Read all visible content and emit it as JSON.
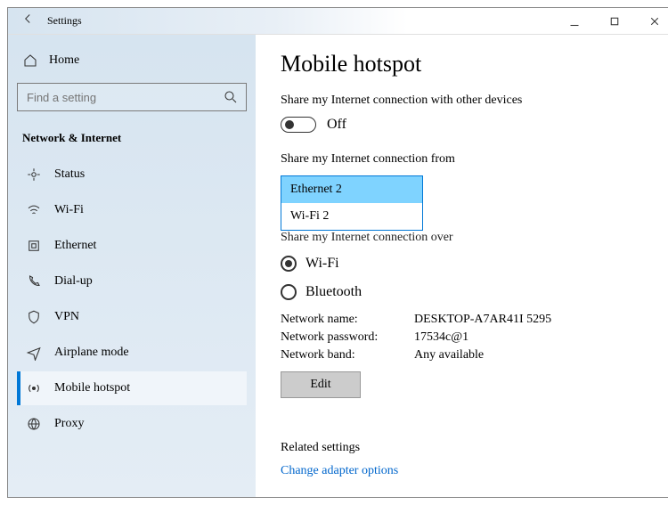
{
  "titlebar": {
    "title": "Settings"
  },
  "sidebar": {
    "home": "Home",
    "search_placeholder": "Find a setting",
    "section": "Network & Internet",
    "items": [
      {
        "label": "Status"
      },
      {
        "label": "Wi-Fi"
      },
      {
        "label": "Ethernet"
      },
      {
        "label": "Dial-up"
      },
      {
        "label": "VPN"
      },
      {
        "label": "Airplane mode"
      },
      {
        "label": "Mobile hotspot"
      },
      {
        "label": "Proxy"
      }
    ]
  },
  "content": {
    "heading": "Mobile hotspot",
    "share_label": "Share my Internet connection with other devices",
    "toggle_state": "Off",
    "from_label": "Share my Internet connection from",
    "from_options": {
      "selected": "Ethernet 2",
      "other": "Wi-Fi 2"
    },
    "over_label": "Share my Internet connection over",
    "over_wifi": "Wi-Fi",
    "over_bt": "Bluetooth",
    "net": {
      "name_l": "Network name:",
      "name_v": "DESKTOP-A7AR41I 5295",
      "pass_l": "Network password:",
      "pass_v": "17534c@1",
      "band_l": "Network band:",
      "band_v": "Any available"
    },
    "edit": "Edit",
    "related_h": "Related settings",
    "related_link": "Change adapter options"
  }
}
